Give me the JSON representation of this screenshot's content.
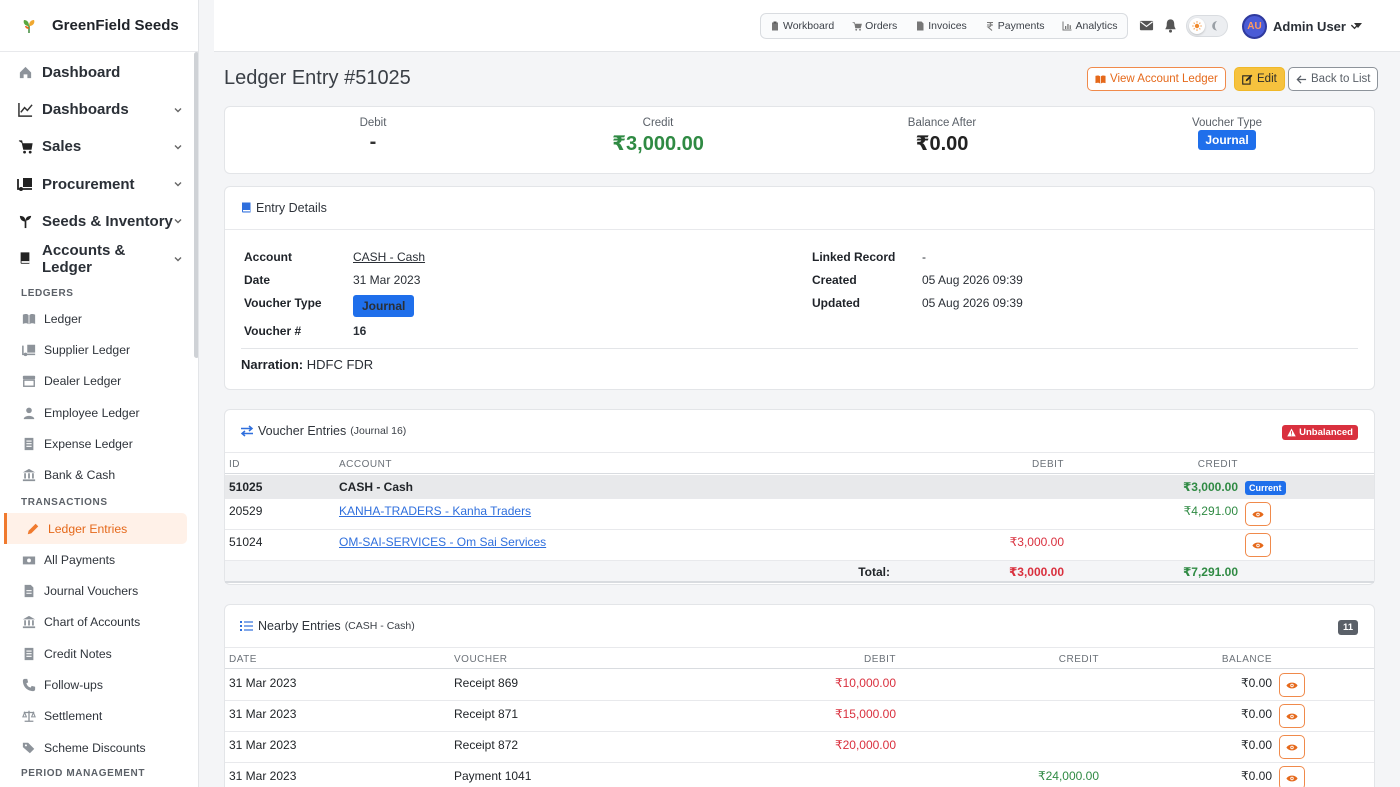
{
  "brand": {
    "name": "GreenField Seeds"
  },
  "sidebar": {
    "top_items": [
      {
        "label": "Dashboard"
      },
      {
        "label": "Dashboards"
      },
      {
        "label": "Sales"
      },
      {
        "label": "Procurement"
      },
      {
        "label": "Seeds & Inventory"
      },
      {
        "label": "Accounts & Ledger"
      }
    ],
    "ledgers_title": "LEDGERS",
    "ledgers": [
      {
        "label": "Ledger"
      },
      {
        "label": "Supplier Ledger"
      },
      {
        "label": "Dealer Ledger"
      },
      {
        "label": "Employee Ledger"
      },
      {
        "label": "Expense Ledger"
      },
      {
        "label": "Bank & Cash"
      }
    ],
    "transactions_title": "TRANSACTIONS",
    "transactions": [
      {
        "label": "Ledger Entries"
      },
      {
        "label": "All Payments"
      },
      {
        "label": "Journal Vouchers"
      },
      {
        "label": "Chart of Accounts"
      },
      {
        "label": "Credit Notes"
      },
      {
        "label": "Follow-ups"
      },
      {
        "label": "Settlement"
      },
      {
        "label": "Scheme Discounts"
      }
    ],
    "period_title": "PERIOD MANAGEMENT"
  },
  "topbar": {
    "quicknav": [
      {
        "label": "Workboard",
        "icon": "clipboard-icon"
      },
      {
        "label": "Orders",
        "icon": "cart-icon"
      },
      {
        "label": "Invoices",
        "icon": "file-icon"
      },
      {
        "label": "Payments",
        "icon": "rupee-icon"
      },
      {
        "label": "Analytics",
        "icon": "chart-icon"
      }
    ],
    "avatar_initials": "AU",
    "user_name": "Admin User"
  },
  "page": {
    "title": "Ledger Entry #51025",
    "btn_view_ledger": "View Account Ledger",
    "btn_edit": "Edit",
    "btn_back": "Back to List"
  },
  "summary": {
    "debit_label": "Debit",
    "debit_value": "-",
    "credit_label": "Credit",
    "credit_value": "₹3,000.00",
    "balance_label": "Balance After",
    "balance_value": "₹0.00",
    "vtype_label": "Voucher Type",
    "vtype_value": "Journal"
  },
  "details": {
    "title": "Entry Details",
    "account_label": "Account",
    "account_value": "CASH - Cash",
    "date_label": "Date",
    "date_value": "31 Mar 2023",
    "vtype_label": "Voucher Type",
    "vtype_value": "Journal",
    "vno_label": "Voucher #",
    "vno_value": "16",
    "linked_label": "Linked Record",
    "linked_value": "-",
    "created_label": "Created",
    "created_value": "05 Aug 2026 09:39",
    "updated_label": "Updated",
    "updated_value": "05 Aug 2026 09:39",
    "narration_label": "Narration:",
    "narration_value": "HDFC FDR"
  },
  "voucher": {
    "title": "Voucher Entries",
    "subtitle": "(Journal 16)",
    "status_badge": "Unbalanced",
    "headers": {
      "id": "ID",
      "account": "ACCOUNT",
      "debit": "DEBIT",
      "credit": "CREDIT"
    },
    "rows": [
      {
        "id": "51025",
        "account": "CASH - Cash",
        "debit": "",
        "credit": "₹3,000.00",
        "badge": "Current"
      },
      {
        "id": "20529",
        "account": "KANHA-TRADERS - Kanha Traders",
        "debit": "",
        "credit": "₹4,291.00"
      },
      {
        "id": "51024",
        "account": "OM-SAI-SERVICES - Om Sai Services",
        "debit": "₹3,000.00",
        "credit": ""
      }
    ],
    "total_label": "Total:",
    "total_debit": "₹3,000.00",
    "total_credit": "₹7,291.00"
  },
  "nearby": {
    "title": "Nearby Entries",
    "subtitle": "(CASH - Cash)",
    "count": "11",
    "headers": {
      "date": "DATE",
      "voucher": "VOUCHER",
      "debit": "DEBIT",
      "credit": "CREDIT",
      "balance": "BALANCE"
    },
    "rows": [
      {
        "date": "31 Mar 2023",
        "voucher": "Receipt 869",
        "debit": "₹10,000.00",
        "credit": "",
        "balance": "₹0.00"
      },
      {
        "date": "31 Mar 2023",
        "voucher": "Receipt 871",
        "debit": "₹15,000.00",
        "credit": "",
        "balance": "₹0.00"
      },
      {
        "date": "31 Mar 2023",
        "voucher": "Receipt 872",
        "debit": "₹20,000.00",
        "credit": "",
        "balance": "₹0.00"
      },
      {
        "date": "31 Mar 2023",
        "voucher": "Payment 1041",
        "debit": "",
        "credit": "₹24,000.00",
        "balance": "₹0.00"
      }
    ]
  },
  "colors": {
    "accent": "#f07a2e",
    "primary": "#1f6feb",
    "danger": "#d9303e",
    "success": "#2f8a43",
    "warning": "#f6c23e"
  }
}
